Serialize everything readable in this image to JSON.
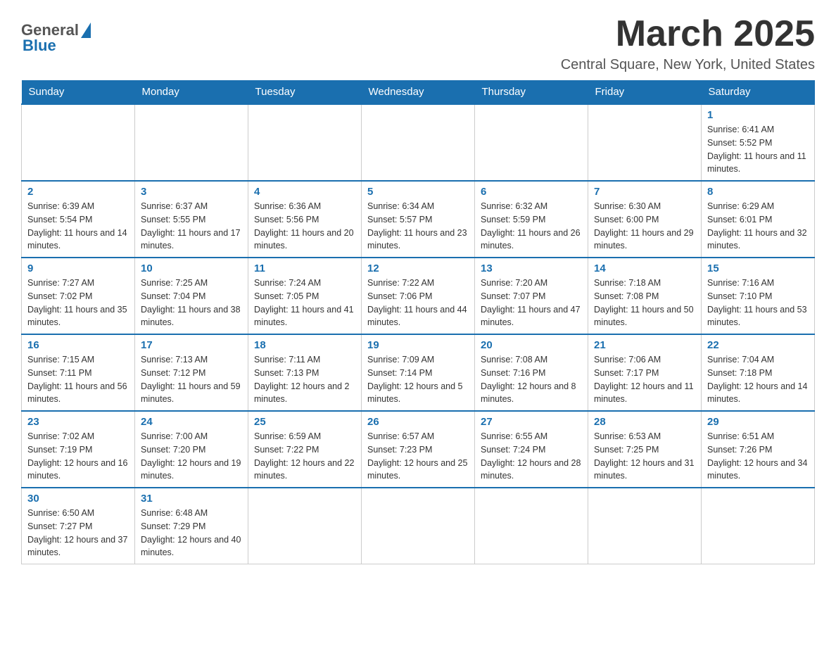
{
  "header": {
    "logo": {
      "general_text": "General",
      "blue_text": "Blue"
    },
    "title": "March 2025",
    "location": "Central Square, New York, United States"
  },
  "days_of_week": [
    "Sunday",
    "Monday",
    "Tuesday",
    "Wednesday",
    "Thursday",
    "Friday",
    "Saturday"
  ],
  "weeks": [
    [
      {
        "day": "",
        "info": ""
      },
      {
        "day": "",
        "info": ""
      },
      {
        "day": "",
        "info": ""
      },
      {
        "day": "",
        "info": ""
      },
      {
        "day": "",
        "info": ""
      },
      {
        "day": "",
        "info": ""
      },
      {
        "day": "1",
        "info": "Sunrise: 6:41 AM\nSunset: 5:52 PM\nDaylight: 11 hours and 11 minutes."
      }
    ],
    [
      {
        "day": "2",
        "info": "Sunrise: 6:39 AM\nSunset: 5:54 PM\nDaylight: 11 hours and 14 minutes."
      },
      {
        "day": "3",
        "info": "Sunrise: 6:37 AM\nSunset: 5:55 PM\nDaylight: 11 hours and 17 minutes."
      },
      {
        "day": "4",
        "info": "Sunrise: 6:36 AM\nSunset: 5:56 PM\nDaylight: 11 hours and 20 minutes."
      },
      {
        "day": "5",
        "info": "Sunrise: 6:34 AM\nSunset: 5:57 PM\nDaylight: 11 hours and 23 minutes."
      },
      {
        "day": "6",
        "info": "Sunrise: 6:32 AM\nSunset: 5:59 PM\nDaylight: 11 hours and 26 minutes."
      },
      {
        "day": "7",
        "info": "Sunrise: 6:30 AM\nSunset: 6:00 PM\nDaylight: 11 hours and 29 minutes."
      },
      {
        "day": "8",
        "info": "Sunrise: 6:29 AM\nSunset: 6:01 PM\nDaylight: 11 hours and 32 minutes."
      }
    ],
    [
      {
        "day": "9",
        "info": "Sunrise: 7:27 AM\nSunset: 7:02 PM\nDaylight: 11 hours and 35 minutes."
      },
      {
        "day": "10",
        "info": "Sunrise: 7:25 AM\nSunset: 7:04 PM\nDaylight: 11 hours and 38 minutes."
      },
      {
        "day": "11",
        "info": "Sunrise: 7:24 AM\nSunset: 7:05 PM\nDaylight: 11 hours and 41 minutes."
      },
      {
        "day": "12",
        "info": "Sunrise: 7:22 AM\nSunset: 7:06 PM\nDaylight: 11 hours and 44 minutes."
      },
      {
        "day": "13",
        "info": "Sunrise: 7:20 AM\nSunset: 7:07 PM\nDaylight: 11 hours and 47 minutes."
      },
      {
        "day": "14",
        "info": "Sunrise: 7:18 AM\nSunset: 7:08 PM\nDaylight: 11 hours and 50 minutes."
      },
      {
        "day": "15",
        "info": "Sunrise: 7:16 AM\nSunset: 7:10 PM\nDaylight: 11 hours and 53 minutes."
      }
    ],
    [
      {
        "day": "16",
        "info": "Sunrise: 7:15 AM\nSunset: 7:11 PM\nDaylight: 11 hours and 56 minutes."
      },
      {
        "day": "17",
        "info": "Sunrise: 7:13 AM\nSunset: 7:12 PM\nDaylight: 11 hours and 59 minutes."
      },
      {
        "day": "18",
        "info": "Sunrise: 7:11 AM\nSunset: 7:13 PM\nDaylight: 12 hours and 2 minutes."
      },
      {
        "day": "19",
        "info": "Sunrise: 7:09 AM\nSunset: 7:14 PM\nDaylight: 12 hours and 5 minutes."
      },
      {
        "day": "20",
        "info": "Sunrise: 7:08 AM\nSunset: 7:16 PM\nDaylight: 12 hours and 8 minutes."
      },
      {
        "day": "21",
        "info": "Sunrise: 7:06 AM\nSunset: 7:17 PM\nDaylight: 12 hours and 11 minutes."
      },
      {
        "day": "22",
        "info": "Sunrise: 7:04 AM\nSunset: 7:18 PM\nDaylight: 12 hours and 14 minutes."
      }
    ],
    [
      {
        "day": "23",
        "info": "Sunrise: 7:02 AM\nSunset: 7:19 PM\nDaylight: 12 hours and 16 minutes."
      },
      {
        "day": "24",
        "info": "Sunrise: 7:00 AM\nSunset: 7:20 PM\nDaylight: 12 hours and 19 minutes."
      },
      {
        "day": "25",
        "info": "Sunrise: 6:59 AM\nSunset: 7:22 PM\nDaylight: 12 hours and 22 minutes."
      },
      {
        "day": "26",
        "info": "Sunrise: 6:57 AM\nSunset: 7:23 PM\nDaylight: 12 hours and 25 minutes."
      },
      {
        "day": "27",
        "info": "Sunrise: 6:55 AM\nSunset: 7:24 PM\nDaylight: 12 hours and 28 minutes."
      },
      {
        "day": "28",
        "info": "Sunrise: 6:53 AM\nSunset: 7:25 PM\nDaylight: 12 hours and 31 minutes."
      },
      {
        "day": "29",
        "info": "Sunrise: 6:51 AM\nSunset: 7:26 PM\nDaylight: 12 hours and 34 minutes."
      }
    ],
    [
      {
        "day": "30",
        "info": "Sunrise: 6:50 AM\nSunset: 7:27 PM\nDaylight: 12 hours and 37 minutes."
      },
      {
        "day": "31",
        "info": "Sunrise: 6:48 AM\nSunset: 7:29 PM\nDaylight: 12 hours and 40 minutes."
      },
      {
        "day": "",
        "info": ""
      },
      {
        "day": "",
        "info": ""
      },
      {
        "day": "",
        "info": ""
      },
      {
        "day": "",
        "info": ""
      },
      {
        "day": "",
        "info": ""
      }
    ]
  ]
}
